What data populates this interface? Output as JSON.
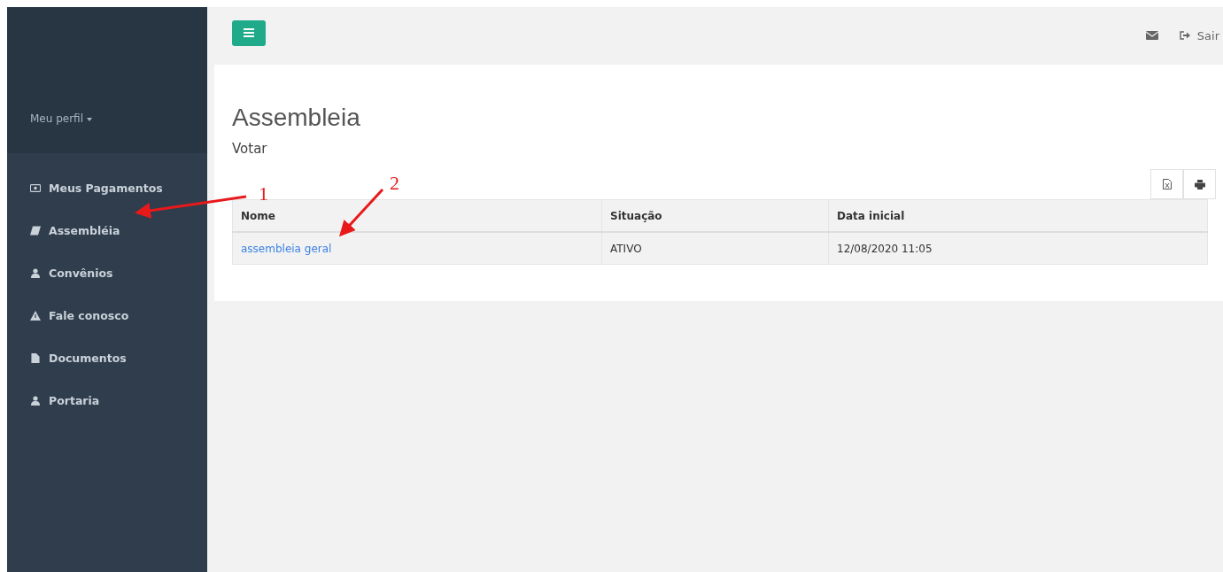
{
  "sidebar": {
    "profile": {
      "label": "Meu perfil"
    },
    "items": [
      {
        "label": "Meus Pagamentos",
        "selected": false
      },
      {
        "label": "Assembléia",
        "selected": false
      },
      {
        "label": "Convênios",
        "selected": false
      },
      {
        "label": "Fale conosco",
        "selected": false
      },
      {
        "label": "Documentos",
        "selected": false
      },
      {
        "label": "Portaria",
        "selected": false
      }
    ]
  },
  "header": {
    "logout": "Sair"
  },
  "page": {
    "title": "Assembleia",
    "subtitle": "Votar"
  },
  "table": {
    "columns": [
      "Nome",
      "Situação",
      "Data inicial"
    ],
    "rows": [
      {
        "cells": [
          "assembleia geral",
          "ATIVO",
          "12/08/2020 11:05"
        ]
      }
    ]
  },
  "annotations": [
    {
      "label": "1"
    },
    {
      "label": "2"
    }
  ]
}
